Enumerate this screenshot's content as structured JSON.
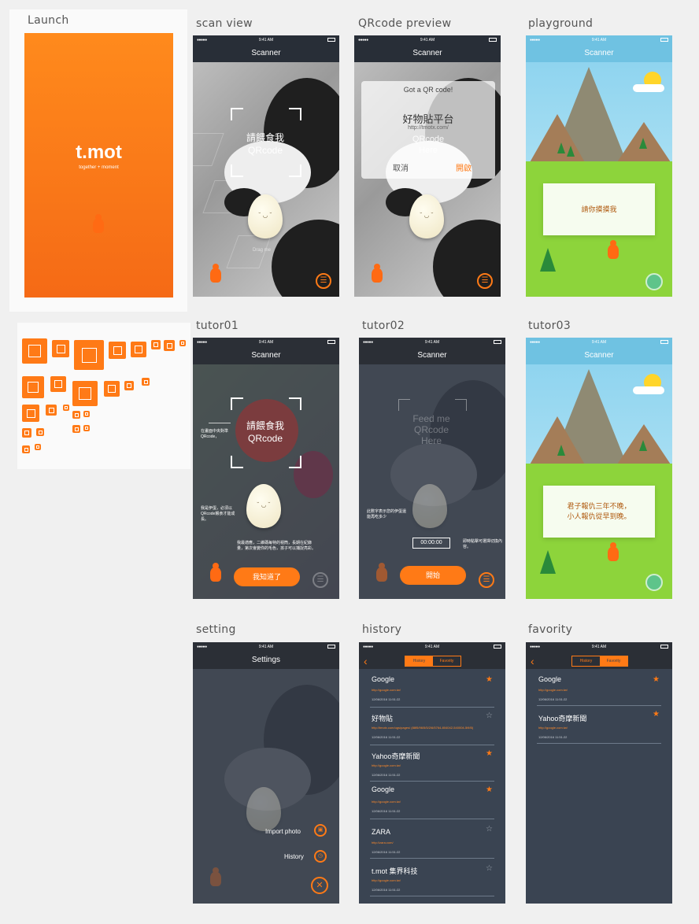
{
  "labels": {
    "launch": "Launch",
    "scan_view": "scan view",
    "qr_preview": "QRcode preview",
    "playground": "playground",
    "tutor01": "tutor01",
    "tutor02": "tutor02",
    "tutor03": "tutor03",
    "setting": "setting",
    "history": "history",
    "favority": "favority"
  },
  "status": {
    "time": "9:41 AM",
    "dots": "●●●●●"
  },
  "launch": {
    "logo": "t.mot",
    "tagline": "together + moment"
  },
  "scanner": {
    "title": "Scanner",
    "scan_line1": "請餵食我",
    "scan_line2": "QRcode",
    "egg_face": "˘ ◡ ˘",
    "hint": "Drag me"
  },
  "qr_dialog": {
    "title": "Got a QR code!",
    "name": "好物貼平台",
    "url": "http://tmotx.com/",
    "faint1": "QRcode",
    "faint2": "Here",
    "cancel": "取消",
    "open": "開啟"
  },
  "playground": {
    "speech": "請你摸摸我"
  },
  "tutor01": {
    "note_left": "在畫面中央對準QRcode，",
    "note_egg": "我是伊蛋，必須以QRcode餵食才能成長。",
    "note_bottom": "我最適應，二維碼每特的視筒，長期在紀錄量，第次會變你的毛色，孩子可以捕捉亮彩。",
    "button": "我知道了"
  },
  "tutor02": {
    "feed1": "Feed me",
    "feed2": "QRcode",
    "feed3": "Here",
    "note_left": "此數字表示您的伊蛋還能再吃多少",
    "timer": "00:00:00",
    "note_right": "即時點擊可選擇切換內容。",
    "button": "開始"
  },
  "tutor03": {
    "speech_line1": "君子報仇三年不晚，",
    "speech_line2": "小人報仇從早到晚。"
  },
  "settings": {
    "title": "Settings",
    "import": "Import photo",
    "history": "History"
  },
  "history": {
    "tab_history": "History",
    "tab_favority": "Favority",
    "items": [
      {
        "title": "Google",
        "url": "http://google.com.tw/",
        "date": "12/06/2016 11:51:22",
        "star": "★"
      },
      {
        "title": "好物貼",
        "url": "http://tmotx.com/ugs/pages/  (88f5/96/5/5/2/6/5764-804042-540004-5f4f5)",
        "date": "12/06/2016 11:51:22",
        "star": "☆"
      },
      {
        "title": "Yahoo奇摩新聞",
        "url": "http://google.com.tw/",
        "date": "12/06/2016 11:51:22",
        "star": "★"
      },
      {
        "title": "Google",
        "url": "http://google.com.tw/",
        "date": "12/06/2016 11:51:22",
        "star": "★"
      },
      {
        "title": "ZARA",
        "url": "http://zara.com/",
        "date": "12/06/2016 11:51:22",
        "star": "☆"
      },
      {
        "title": "t.mot 集界科技",
        "url": "http://google.com.tw/",
        "date": "12/06/2016 11:51:22",
        "star": "☆"
      }
    ]
  },
  "favority": {
    "items": [
      {
        "title": "Google",
        "url": "http://google.com.tw/",
        "date": "12/06/2016 11:51:22",
        "star": "★"
      },
      {
        "title": "Yahoo奇摩新聞",
        "url": "http://google.com.tw/",
        "date": "12/06/2016 11:51:22",
        "star": "★"
      }
    ]
  },
  "colors": {
    "accent": "#ff7a16",
    "dark": "#3a4452"
  }
}
